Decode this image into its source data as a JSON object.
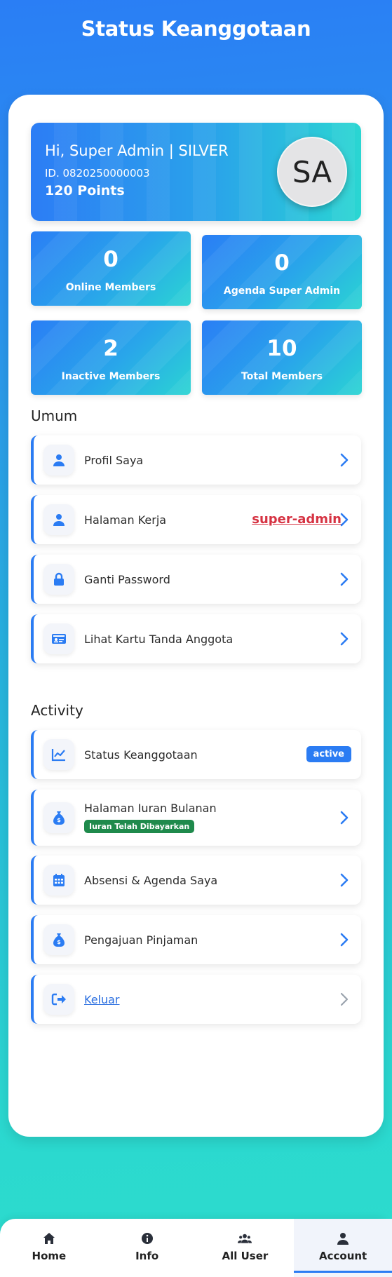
{
  "header": {
    "title": "Status Keanggotaan"
  },
  "profile": {
    "greeting": "Hi, Super Admin | SILVER",
    "id_text": "ID. 0820250000003",
    "points_text": "120 Points",
    "avatar_initials": "SA"
  },
  "stats": [
    {
      "value": "0",
      "label": "Online Members"
    },
    {
      "value": "0",
      "label": "Agenda Super Admin"
    },
    {
      "value": "2",
      "label": "Inactive Members"
    },
    {
      "value": "10",
      "label": "Total Members"
    }
  ],
  "sections": {
    "umum": {
      "title": "Umum",
      "items": [
        {
          "label": "Profil Saya",
          "icon": "user-icon"
        },
        {
          "label": "Halaman Kerja",
          "icon": "user-icon",
          "role": "super-admin "
        },
        {
          "label": "Ganti Password",
          "icon": "lock-icon"
        },
        {
          "label": "Lihat Kartu Tanda Anggota",
          "icon": "id-card-icon"
        }
      ]
    },
    "activity": {
      "title": "Activity",
      "items": [
        {
          "label": "Status Keanggotaan",
          "icon": "chart-line-icon",
          "badge": "active"
        },
        {
          "label": "Halaman Iuran Bulanan",
          "icon": "money-bag-icon",
          "badge": "Iuran Telah Dibayarkan"
        },
        {
          "label": "Absensi & Agenda Saya",
          "icon": "calendar-icon"
        },
        {
          "label": "Pengajuan Pinjaman",
          "icon": "money-bag-icon"
        },
        {
          "label": "Keluar",
          "icon": "logout-icon"
        }
      ]
    }
  },
  "bottom_nav": [
    {
      "label": "Home",
      "icon": "home-icon"
    },
    {
      "label": "Info",
      "icon": "info-icon"
    },
    {
      "label": "All User",
      "icon": "users-icon"
    },
    {
      "label": "Account",
      "icon": "account-icon",
      "active": true
    }
  ],
  "colors": {
    "accent": "#2b7cf3",
    "role_red": "#d63343",
    "paid_green": "#1f8a4c"
  }
}
